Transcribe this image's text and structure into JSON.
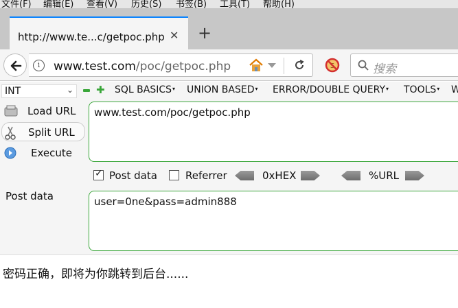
{
  "menu": [
    "文件(F)",
    "编辑(E)",
    "查看(V)",
    "历史(S)",
    "书签(B)",
    "工具(T)",
    "帮助(H)"
  ],
  "tab": {
    "title": "http://www.te...c/getpoc.php",
    "close": "✕",
    "new_tab": "+"
  },
  "navbar": {
    "url_host": "www.test.com",
    "url_path": "/poc/getpoc.php",
    "search_placeholder": "搜索"
  },
  "hackbar": {
    "select_value": "INT",
    "menus": [
      "SQL BASICS",
      "UNION BASED",
      "ERROR/DOUBLE QUERY",
      "TOOLS",
      "W"
    ],
    "load_url": "Load URL",
    "split_url": "Split URL",
    "execute": "Execute",
    "url_value": "www.test.com/poc/getpoc.php",
    "post_data_checkbox": "Post data",
    "post_data_checked": true,
    "referrer_checkbox": "Referrer",
    "referrer_checked": false,
    "hex_label": "0xHEX",
    "url_enc_label": "%URL",
    "post_data_label": "Post data",
    "post_value": "user=0ne&pass=admin888"
  },
  "page": {
    "message": "密码正确，即将为你跳转到后台......"
  },
  "colors": {
    "accent_green": "#3aa63a",
    "tab_highlight": "#0a84ff"
  }
}
